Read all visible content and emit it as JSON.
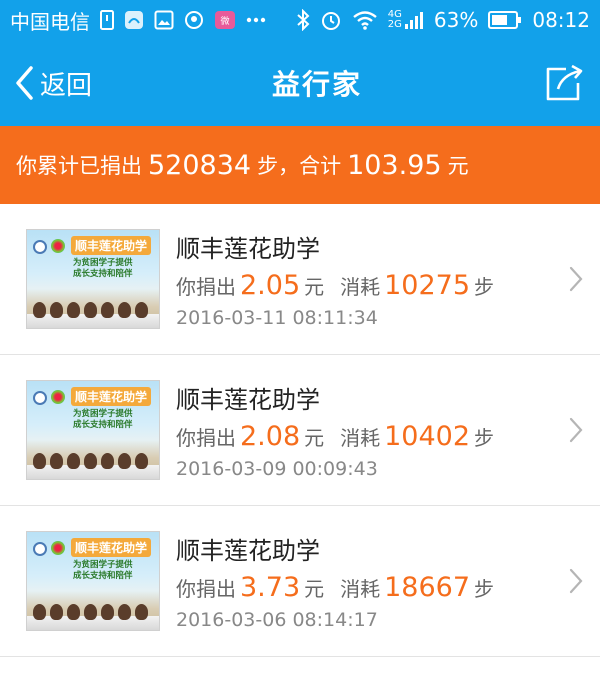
{
  "status_bar": {
    "carrier": "中国电信",
    "network_top": "4G",
    "network_bottom": "2G",
    "battery": "63%",
    "time": "08:12"
  },
  "nav": {
    "back_label": "返回",
    "title": "益行家"
  },
  "summary": {
    "prefix": "你累计已捐出",
    "steps": "520834",
    "steps_unit": "步，合计",
    "amount": "103.95",
    "amount_unit": "元"
  },
  "donations": [
    {
      "title": "顺丰莲花助学",
      "donated_label": "你捐出",
      "amount": "2.05",
      "amount_unit": "元",
      "consumed_label": "消耗",
      "steps": "10275",
      "steps_unit": "步",
      "datetime": "2016-03-11 08:11:34"
    },
    {
      "title": "顺丰莲花助学",
      "donated_label": "你捐出",
      "amount": "2.08",
      "amount_unit": "元",
      "consumed_label": "消耗",
      "steps": "10402",
      "steps_unit": "步",
      "datetime": "2016-03-09 00:09:43"
    },
    {
      "title": "顺丰莲花助学",
      "donated_label": "你捐出",
      "amount": "3.73",
      "amount_unit": "元",
      "consumed_label": "消耗",
      "steps": "18667",
      "steps_unit": "步",
      "datetime": "2016-03-06 08:14:17"
    }
  ],
  "thumbnail": {
    "banner": "顺丰莲花助学",
    "slogan_1": "为贫困学子提供",
    "slogan_2": "成长支持和陪伴"
  },
  "colors": {
    "primary": "#12a1ea",
    "accent": "#f56d1c"
  }
}
